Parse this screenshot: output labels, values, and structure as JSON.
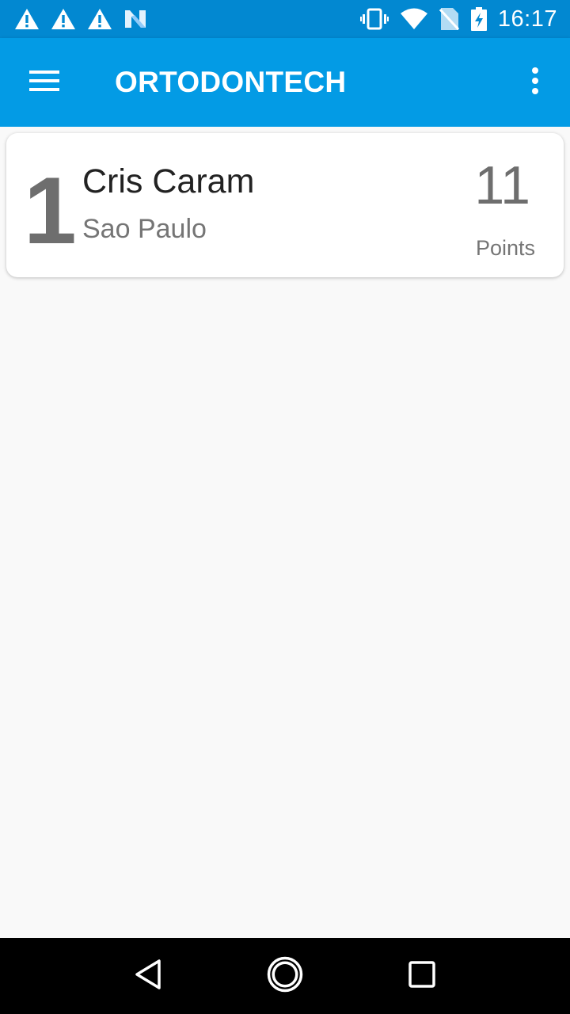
{
  "status_bar": {
    "time": "16:17",
    "left_icons": [
      "warning-icon",
      "warning-icon",
      "warning-icon",
      "n-notification-icon"
    ],
    "right_icons": [
      "vibrate-icon",
      "wifi-icon",
      "no-sim-icon",
      "battery-charging-icon"
    ]
  },
  "app_bar": {
    "title": "ORTODONTECH",
    "menu_icon": "hamburger-menu-icon",
    "overflow_icon": "more-vert-icon",
    "color": "#039be5"
  },
  "ranking": [
    {
      "rank": "1",
      "name": "Cris Caram",
      "city": "Sao Paulo",
      "points": "11",
      "points_label": "Points"
    }
  ],
  "nav_bar": {
    "icons": [
      "back-icon",
      "home-icon",
      "recents-icon"
    ]
  },
  "colors": {
    "status_bar": "#0288d1",
    "app_bar": "#039be5",
    "background": "#f9f9f9"
  }
}
